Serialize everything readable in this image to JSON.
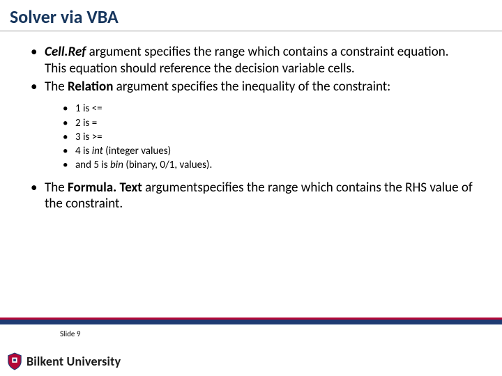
{
  "title": "Solver via VBA",
  "bullets": {
    "b1": {
      "bold": "Cell.Ref",
      "rest": " argument specifies the range which contains a constraint equation. This equation should reference the decision variable cells."
    },
    "b2": {
      "pre": "The ",
      "bold": "Relation",
      "rest": " argument specifies the inequality of the constraint:"
    },
    "sub": {
      "s1": "1 is <=",
      "s2": "2 is =",
      "s3": "3 is >=",
      "s4": {
        "pre": "4 is ",
        "it": "int",
        "post": " (integer values)"
      },
      "s5": {
        "pre": "and 5 is ",
        "it": "bin",
        "post": " (binary, 0/1, values)."
      }
    },
    "b3": {
      "pre": "The ",
      "bold": "Formula. Text",
      "rest": " argumentspecifies the range which contains the RHS value of the constraint."
    }
  },
  "footer": {
    "slide": "Slide 9",
    "university": "Bilkent University"
  }
}
